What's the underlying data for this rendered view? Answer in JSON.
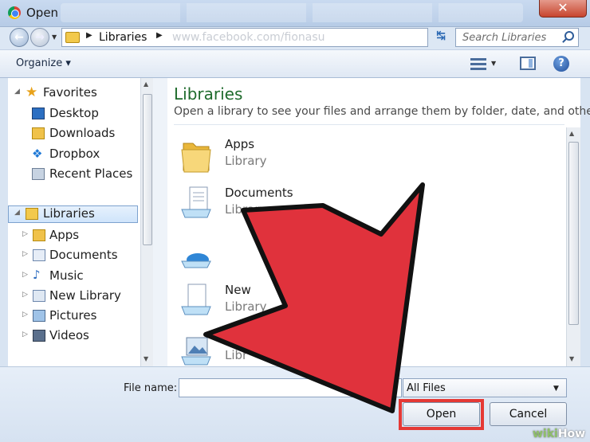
{
  "window": {
    "title": "Open",
    "close_label": "✕"
  },
  "address": {
    "root": "Libraries",
    "ghost_text": "www.facebook.com/fionasu"
  },
  "search": {
    "placeholder": "Search Libraries"
  },
  "toolbar": {
    "organize_label": "Organize ▾"
  },
  "nav": {
    "favorites": {
      "label": "Favorites",
      "items": [
        "Desktop",
        "Downloads",
        "Dropbox",
        "Recent Places"
      ]
    },
    "libraries": {
      "label": "Libraries",
      "items": [
        "Apps",
        "Documents",
        "Music",
        "New Library",
        "Pictures",
        "Videos"
      ]
    }
  },
  "content": {
    "title": "Libraries",
    "subtitle": "Open a library to see your files and arrange them by folder, date, and other...",
    "items": [
      {
        "name": "Apps",
        "kind": "Library"
      },
      {
        "name": "Documents",
        "kind": "Library"
      },
      {
        "name": "",
        "kind": ""
      },
      {
        "name": "New",
        "kind": "Library"
      },
      {
        "name": "",
        "kind": "Libr"
      }
    ]
  },
  "bottom": {
    "file_name_label": "File name:",
    "file_name_value": "",
    "filter": "All Files",
    "open_label": "Open",
    "cancel_label": "Cancel"
  },
  "watermark": {
    "prefix": "wiki",
    "suffix": "How"
  },
  "colors": {
    "arrow_fill": "#e0323c",
    "highlight": "#e53935",
    "library_title": "#1e6b2c"
  }
}
